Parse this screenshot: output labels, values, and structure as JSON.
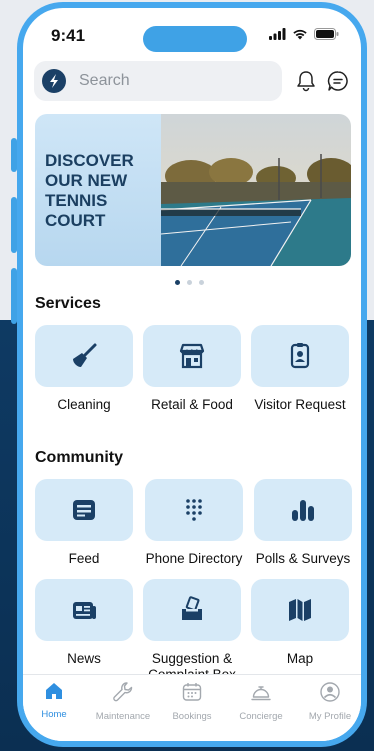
{
  "status_bar": {
    "time": "9:41"
  },
  "search": {
    "placeholder": "Search"
  },
  "banner": {
    "title": "DISCOVER OUR NEW TENNIS COURT"
  },
  "services": {
    "title": "Services",
    "items": [
      {
        "label": "Cleaning",
        "icon": "broom-icon"
      },
      {
        "label": "Retail & Food",
        "icon": "storefront-icon"
      },
      {
        "label": "Visitor Request",
        "icon": "visitor-badge-icon"
      }
    ]
  },
  "community": {
    "title": "Community",
    "items": [
      {
        "label": "Feed",
        "icon": "feed-icon"
      },
      {
        "label": "Phone Directory",
        "icon": "dialpad-icon"
      },
      {
        "label": "Polls & Surveys",
        "icon": "bar-chart-icon"
      },
      {
        "label": "News",
        "icon": "newspaper-icon"
      },
      {
        "label": "Suggestion & Complaint Box",
        "icon": "ballot-box-icon"
      },
      {
        "label": "Map",
        "icon": "map-icon"
      }
    ]
  },
  "nav": {
    "items": [
      {
        "label": "Home",
        "active": true
      },
      {
        "label": "Maintenance"
      },
      {
        "label": "Bookings"
      },
      {
        "label": "Concierge"
      },
      {
        "label": "My Profile"
      }
    ]
  },
  "colors": {
    "accent": "#3fa2e6",
    "primary": "#1b4066",
    "tile": "#d6eaf8"
  }
}
